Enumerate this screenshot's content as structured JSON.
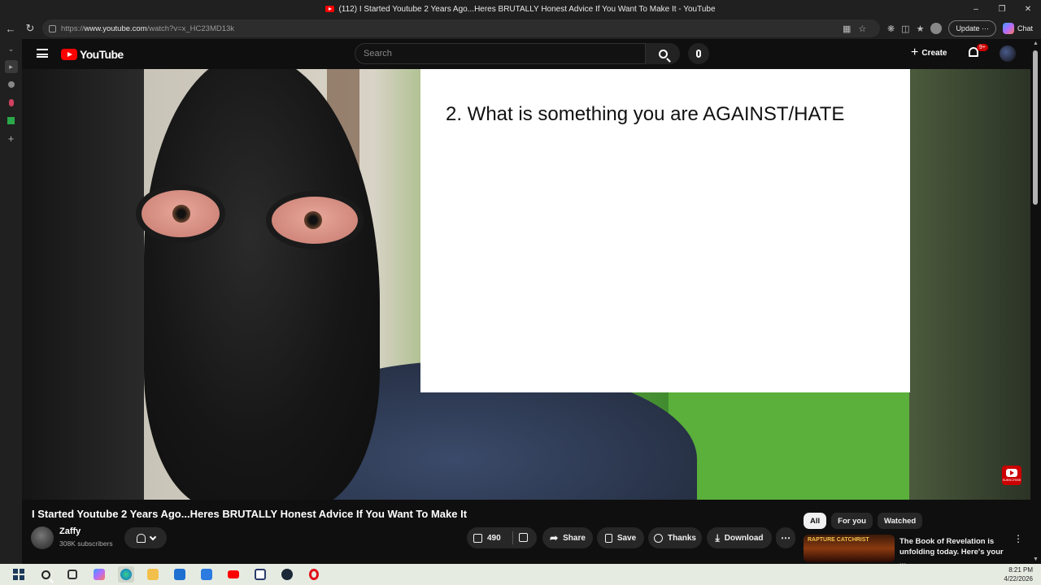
{
  "browser": {
    "tab_title": "(112) I Started Youtube 2 Years Ago...Heres BRUTALLY Honest Advice If You Want To Make It - YouTube",
    "url_prefix": "https://",
    "url_host": "www.youtube.com",
    "url_path": "/watch?v=x_HC23MD13k",
    "update_label": "Update",
    "chat_label": "Chat"
  },
  "youtube": {
    "logo_text": "YouTube",
    "search_placeholder": "Search",
    "create_label": "Create",
    "notification_badge": "9+"
  },
  "video": {
    "slide_text": "2. What is something you are AGAINST/HATE",
    "title": "I Started Youtube 2 Years Ago...Heres BRUTALLY Honest Advice If You Want To Make It",
    "channel_name": "Zaffy",
    "subscribers": "308K subscribers",
    "like_count": "490",
    "share_label": "Share",
    "save_label": "Save",
    "thanks_label": "Thanks",
    "download_label": "Download"
  },
  "sidebar": {
    "chips": [
      "All",
      "For you",
      "Watched"
    ],
    "recommendation": {
      "title": "The Book of Revelation is unfolding today. Here's your ...",
      "thumb_text": "RAPTURE CATCHRIST"
    }
  },
  "taskbar": {
    "time": "8:21 PM",
    "date": "4/22/2026"
  },
  "colors": {
    "youtube_red": "#ff0000",
    "background": "#0f0f0f",
    "pill": "#272727"
  }
}
